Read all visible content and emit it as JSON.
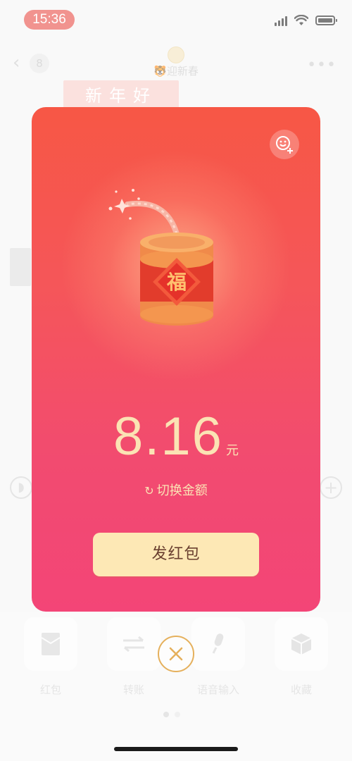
{
  "status_bar": {
    "time": "15:36"
  },
  "chat": {
    "unread_count": "8",
    "title": "🐯迎新春",
    "banner_text": "新年好"
  },
  "panel": {
    "items": [
      {
        "label": "红包",
        "icon": "red-packet-icon"
      },
      {
        "label": "转账",
        "icon": "transfer-icon"
      },
      {
        "label": "语音输入",
        "icon": "microphone-icon"
      },
      {
        "label": "收藏",
        "icon": "box-icon"
      }
    ]
  },
  "red_packet": {
    "amount": "8.16",
    "unit": "元",
    "switch_label": "切换金额",
    "stamp_char": "福",
    "send_label": "发红包"
  },
  "colors": {
    "card_top": "#f75745",
    "card_bottom": "#f34577",
    "amount_text": "#fbe3b4",
    "send_button": "#fde8b5",
    "close_ring": "#e5b05c"
  }
}
